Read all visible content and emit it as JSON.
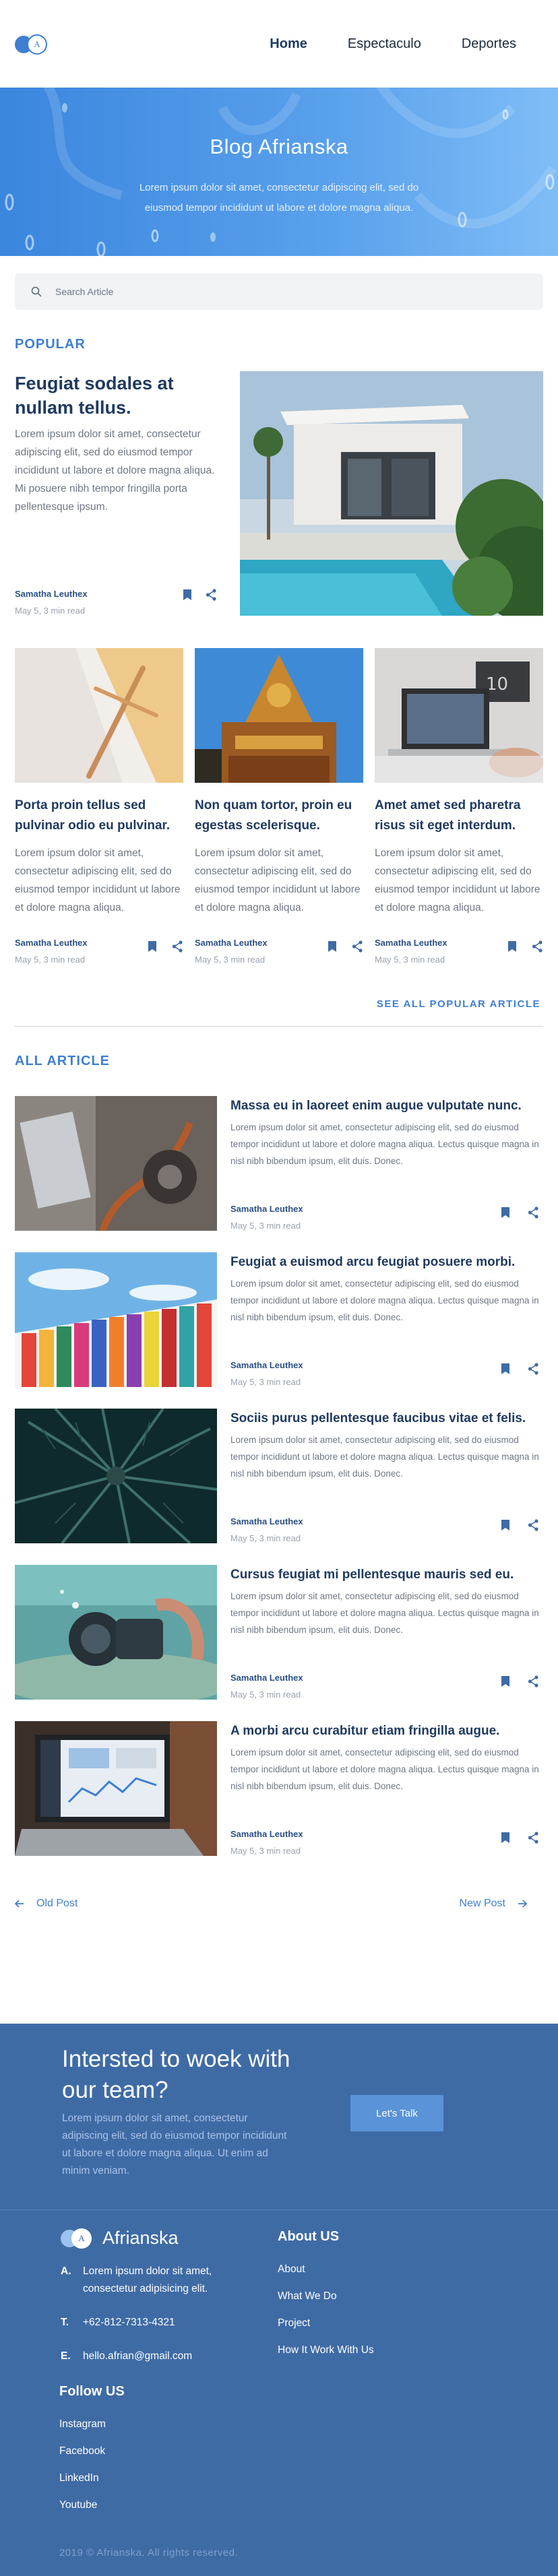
{
  "header": {
    "logo_letter": "A",
    "nav": [
      "Home",
      "Espectaculo",
      "Deportes"
    ]
  },
  "hero": {
    "title": "Blog Afrianska",
    "subtitle": "Lorem ipsum dolor sit amet, consectetur adipiscing elit, sed do eiusmod tempor incididunt ut labore et dolore magna aliqua."
  },
  "search": {
    "placeholder": "Search Article"
  },
  "popular": {
    "title": "POPULAR",
    "featured": {
      "title": "Feugiat sodales at nullam tellus.",
      "excerpt": "Lorem ipsum dolor sit amet, consectetur adipiscing elit, sed do eiusmod tempor incididunt ut labore et dolore magna aliqua. Mi posuere nibh tempor fringilla porta pellentesque ipsum.",
      "author": "Samatha Leuthex",
      "date": "May 5, 3 min read"
    },
    "cards": [
      {
        "title": "Porta proin tellus sed pulvinar odio eu pulvinar.",
        "excerpt": "Lorem ipsum dolor sit amet, consectetur adipiscing elit, sed do eiusmod tempor incididunt ut labore et dolore magna aliqua.",
        "author": "Samatha Leuthex",
        "date": "May 5, 3 min read"
      },
      {
        "title": "Non quam tortor, proin eu egestas scelerisque.",
        "excerpt": "Lorem ipsum dolor sit amet, consectetur adipiscing elit, sed do eiusmod tempor incididunt ut labore et dolore magna aliqua.",
        "author": "Samatha Leuthex",
        "date": "May 5, 3 min read"
      },
      {
        "title": "Amet amet sed pharetra risus sit eget interdum.",
        "excerpt": "Lorem ipsum dolor sit amet, consectetur adipiscing elit, sed do eiusmod tempor incididunt ut labore et dolore magna aliqua.",
        "author": "Samatha Leuthex",
        "date": "May 5, 3 min read"
      }
    ],
    "see_all": "SEE ALL POPULAR ARTICLE"
  },
  "all_article": {
    "title": "ALL ARTICLE",
    "items": [
      {
        "title": "Massa eu in laoreet enim augue vulputate nunc.",
        "excerpt": "Lorem ipsum dolor sit amet, consectetur adipiscing elit, sed do eiusmod tempor incididunt ut labore et dolore magna aliqua. Lectus quisque magna in nisl nibh bibendum ipsum, elit duis. Donec.",
        "author": "Samatha Leuthex",
        "date": "May 5, 3 min read"
      },
      {
        "title": "Feugiat a euismod arcu feugiat posuere morbi.",
        "excerpt": "Lorem ipsum dolor sit amet, consectetur adipiscing elit, sed do eiusmod tempor incididunt ut labore et dolore magna aliqua. Lectus quisque magna in nisl nibh bibendum ipsum, elit duis. Donec.",
        "author": "Samatha Leuthex",
        "date": "May 5, 3 min read"
      },
      {
        "title": "Sociis purus pellentesque faucibus vitae et felis.",
        "excerpt": "Lorem ipsum dolor sit amet, consectetur adipiscing elit, sed do eiusmod tempor incididunt ut labore et dolore magna aliqua. Lectus quisque magna in nisl nibh bibendum ipsum, elit duis. Donec.",
        "author": "Samatha Leuthex",
        "date": "May 5, 3 min read"
      },
      {
        "title": "Cursus feugiat mi pellentesque mauris sed eu.",
        "excerpt": "Lorem ipsum dolor sit amet, consectetur adipiscing elit, sed do eiusmod tempor incididunt ut labore et dolore magna aliqua. Lectus quisque magna in nisl nibh bibendum ipsum, elit duis. Donec.",
        "author": "Samatha Leuthex",
        "date": "May 5, 3 min read"
      },
      {
        "title": "A morbi arcu curabitur etiam fringilla augue.",
        "excerpt": "Lorem ipsum dolor sit amet, consectetur adipiscing elit, sed do eiusmod tempor incididunt ut labore et dolore magna aliqua. Lectus quisque magna in nisl nibh bibendum ipsum, elit duis. Donec.",
        "author": "Samatha Leuthex",
        "date": "May 5, 3 min read"
      }
    ]
  },
  "pager": {
    "old": "Old Post",
    "new": "New Post"
  },
  "cta": {
    "title": "Intersted to woek with our team?",
    "text": "Lorem ipsum dolor sit amet, consectetur adipiscing elit, sed do eiusmod tempor incididunt ut labore et dolore magna aliqua. Ut enim ad minim veniam.",
    "button": "Let's Talk"
  },
  "footer": {
    "logo_letter": "A",
    "brand": "Afrianska",
    "contact": [
      {
        "key": "A.",
        "value": "Lorem ipsum dolor sit amet, consectetur adipisicing elit."
      },
      {
        "key": "T.",
        "value": "+62-812-7313-4321"
      },
      {
        "key": "E.",
        "value": "hello.afrian@gmail.com"
      }
    ],
    "about_title": "About US",
    "about_links": [
      "About",
      "What We Do",
      "Project",
      "How It Work With Us"
    ],
    "follow_title": "Follow US",
    "follow_links": [
      "Instagram",
      "Facebook",
      "LinkedIn",
      "Youtube"
    ],
    "copyright": "2019 © Afrianska. All rights reserved."
  },
  "colors": {
    "accent": "#3f7fd1",
    "heading": "#1f3a5f",
    "footer_bg": "#3f6ba5"
  },
  "icons": [
    "search-icon",
    "bookmark-icon",
    "share-icon",
    "arrow-left-icon",
    "arrow-right-icon"
  ]
}
